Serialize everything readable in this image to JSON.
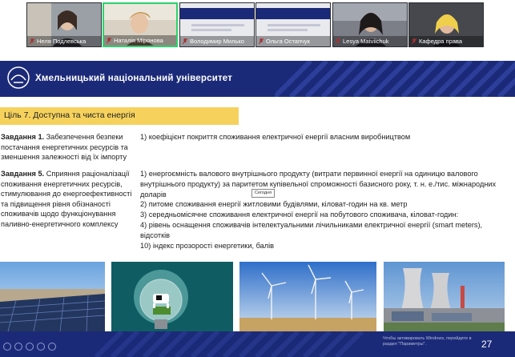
{
  "participants": [
    {
      "name": "Неля Подлевська",
      "muted": true,
      "active": false
    },
    {
      "name": "Наталія Міронова",
      "muted": true,
      "active": true
    },
    {
      "name": "Володимир Милько",
      "muted": true,
      "active": false
    },
    {
      "name": "Ольга Остапчук",
      "muted": true,
      "active": false
    },
    {
      "name": "Lesya Matviichuk",
      "muted": true,
      "active": false
    },
    {
      "name": "Кафедра права",
      "muted": true,
      "active": false
    }
  ],
  "slide": {
    "university": "Хмельницький національний університет",
    "goal": "Ціль 7. Доступна та чиста енергія",
    "task1": {
      "label": "Завдання 1.",
      "text": "Забезпечення безпеки постачання енергетичних ресурсів та зменшення залежності від їх імпорту",
      "measures": [
        "1) коефіцієнт покриття споживання електричної енергії власним виробництвом"
      ]
    },
    "task5": {
      "label": "Завдання 5.",
      "text": "Сприяння раціоналізації споживання енергетичних ресурсів, стимулювання до енергоефективності та підвищення рівня обізнаності споживачів щодо функціонування паливно-енергетичного комплексу",
      "measures": [
        "1) енергоємність валового внутрішнього продукту (витрати первинної енергії на одиницю валового внутрішнього продукту) за паритетом купівельної спроможності базисного року, т. н. е./тис. міжнародних доларів",
        "2) питоме споживання енергії житловими будівлями, кіловат-годин на кв. метр",
        "3) середньомісячне споживання електричної енергії на побутового споживача, кіловат-годин:",
        "4) рівень оснащення споживачів інтелектуальними лічильниками електричної енергії (smart meters), відсотків",
        "10) індекс прозорості енергетики, балів"
      ]
    },
    "tooltip": "Сегодня",
    "windows_notice": "Чтобы активировать Windows, перейдите в раздел \"Параметры\".",
    "page_number": "27"
  },
  "colors": {
    "banner": "#1b2a78",
    "goal_highlight": "#f6d25d",
    "active_speaker": "#2ad36b"
  },
  "icons": [
    "mic-muted-icon",
    "university-logo",
    "prev-slide-icon",
    "next-slide-icon",
    "menu-icon",
    "pen-icon",
    "zoom-icon"
  ]
}
